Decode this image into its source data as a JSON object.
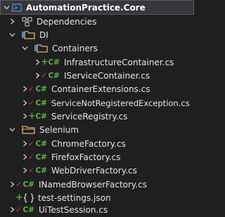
{
  "solution_explorer": {
    "items": [
      {
        "label": "AutomationPractice.Core",
        "kind": "project",
        "expanded": true,
        "status": "",
        "selected": true
      },
      {
        "label": "Dependencies",
        "kind": "dependencies",
        "expanded": false,
        "status": ""
      },
      {
        "label": "DI",
        "kind": "folder",
        "expanded": true,
        "status": "check"
      },
      {
        "label": "Containers",
        "kind": "folder",
        "expanded": true,
        "status": "check"
      },
      {
        "label": "InfrastructureContainer.cs",
        "kind": "cs-file",
        "expanded": false,
        "status": "plus"
      },
      {
        "label": "IServiceContainer.cs",
        "kind": "cs-file",
        "expanded": false,
        "status": "check"
      },
      {
        "label": "ContainerExtensions.cs",
        "kind": "cs-file",
        "expanded": false,
        "status": "check"
      },
      {
        "label": "ServiceNotRegisteredException.cs",
        "kind": "cs-file",
        "expanded": false,
        "status": "check"
      },
      {
        "label": "ServiceRegistry.cs",
        "kind": "cs-file",
        "expanded": false,
        "status": "plus"
      },
      {
        "label": "Selenium",
        "kind": "folder",
        "expanded": true,
        "status": ""
      },
      {
        "label": "ChromeFactory.cs",
        "kind": "cs-file",
        "expanded": false,
        "status": "check"
      },
      {
        "label": "FirefoxFactory.cs",
        "kind": "cs-file",
        "expanded": false,
        "status": "check"
      },
      {
        "label": "WebDriverFactory.cs",
        "kind": "cs-file",
        "expanded": false,
        "status": "check"
      },
      {
        "label": "INamedBrowserFactory.cs",
        "kind": "cs-file",
        "expanded": false,
        "status": "check"
      },
      {
        "label": "test-settings.json",
        "kind": "json-file",
        "expanded": false,
        "status": "plus"
      },
      {
        "label": "UiTestSession.cs",
        "kind": "cs-file",
        "expanded": false,
        "status": "check"
      }
    ],
    "cs_icon_text": "C#",
    "colors": {
      "background": "#1f1f1f",
      "selected": "#37373d",
      "folder": "#dcb67a",
      "csharp": "#5fb548",
      "modified": "#d13438",
      "added": "#57a64a",
      "project": "#4b8bd6"
    }
  }
}
